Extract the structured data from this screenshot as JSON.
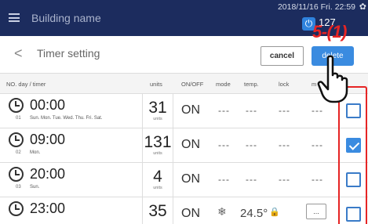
{
  "header": {
    "building_name": "Building name",
    "datetime": "2018/11/16 Fri. 22:59",
    "unit_count": "127"
  },
  "titlebar": {
    "title": "Timer setting",
    "cancel_label": "cancel",
    "delete_label": "delete"
  },
  "annotation": "5-(1)",
  "columns": {
    "no_timer": "NO. day / timer",
    "units": "units",
    "onoff": "ON/OFF",
    "mode": "mode",
    "temp": "temp.",
    "lock": "lock",
    "more": "m"
  },
  "rows": [
    {
      "time": "00:00",
      "no": "01",
      "days": "Sun. Mon. Tue. Wed. Thu. Fri. Sat.",
      "units": "31",
      "units_label": "units",
      "onoff": "ON",
      "mode": "---",
      "temp": "---",
      "lock": "---",
      "extra": "---",
      "checked": false
    },
    {
      "time": "09:00",
      "no": "02",
      "days": "Mon.",
      "units": "131",
      "units_label": "units",
      "onoff": "ON",
      "mode": "---",
      "temp": "---",
      "lock": "---",
      "extra": "---",
      "checked": true
    },
    {
      "time": "20:00",
      "no": "03",
      "days": "Sun.",
      "units": "4",
      "units_label": "units",
      "onoff": "ON",
      "mode": "---",
      "temp": "---",
      "lock": "---",
      "extra": "---",
      "checked": false
    },
    {
      "time": "23:00",
      "units": "35",
      "onoff": "ON",
      "temp": "24.5°",
      "more": "...",
      "checked": false
    }
  ],
  "colors": {
    "header_bg": "#1c2c5e",
    "accent": "#3a8be0",
    "annotation": "#e62424"
  },
  "icons": {
    "menu": "menu-icon",
    "power": "power-icon",
    "gear": "gear-icon",
    "back": "back-chevron-icon",
    "clock": "clock-icon",
    "mode": "snowflake-icon",
    "lock": "lock-icon",
    "pointer": "pointing-hand-icon"
  }
}
